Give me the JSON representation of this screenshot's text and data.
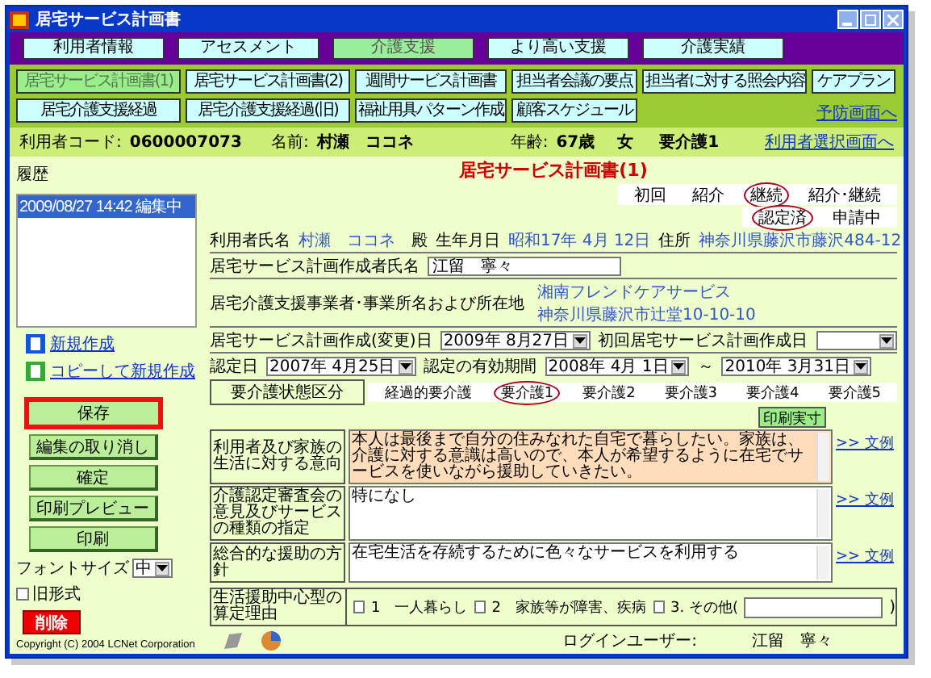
{
  "window": {
    "title": "居宅サービス計画書"
  },
  "main_tabs": [
    {
      "label": "利用者情報",
      "selected": false
    },
    {
      "label": "アセスメント",
      "selected": false
    },
    {
      "label": "介護支援",
      "selected": true
    },
    {
      "label": "より高い支援",
      "selected": false
    },
    {
      "label": "介護実績",
      "selected": false
    }
  ],
  "sub_tabs": [
    {
      "label": "居宅サービス計画書(1)",
      "selected": true
    },
    {
      "label": "居宅サービス計画書(2)",
      "selected": false
    },
    {
      "label": "週間サービス計画書",
      "selected": false
    },
    {
      "label": "担当者会議の要点",
      "selected": false
    },
    {
      "label": "担当者に対する照会内容",
      "selected": false
    },
    {
      "label": "ケアプラン",
      "selected": false
    },
    {
      "label": "居宅介護支援経過",
      "selected": false
    },
    {
      "label": "居宅介護支援経過(旧)",
      "selected": false
    },
    {
      "label": "福祉用具パターン作成",
      "selected": false
    },
    {
      "label": "顧客スケジュール",
      "selected": false
    }
  ],
  "prevention_link": "予防画面へ",
  "user_bar": {
    "code_label": "利用者コード:",
    "code": "0600007073",
    "name_label": "名前:",
    "name": "村瀬　ココネ",
    "age_label": "年齢:",
    "age": "67歳",
    "sex": "女",
    "care_level": "要介護1",
    "select_link": "利用者選択画面へ"
  },
  "history": {
    "title": "履歴",
    "items": [
      {
        "text": "2009/08/27 14:42 編集中",
        "selected": true
      }
    ]
  },
  "new_link": "新規作成",
  "copy_link": "コピーして新規作成",
  "buttons": [
    {
      "label": "保存",
      "highlighted": true
    },
    {
      "label": "編集の取り消し",
      "highlighted": false
    },
    {
      "label": "確定",
      "highlighted": false
    },
    {
      "label": "印刷プレビュー",
      "highlighted": false
    },
    {
      "label": "印刷",
      "highlighted": false
    }
  ],
  "font_size": {
    "label": "フォントサイズ",
    "value": "中"
  },
  "old_format": {
    "label": "旧形式",
    "checked": false
  },
  "delete_button": "削除",
  "copyright": "Copyright (C) 2004 LCNet Corporation",
  "form": {
    "heading": "居宅サービス計画書(1)",
    "plan_types": [
      {
        "label": "初回",
        "selected": false
      },
      {
        "label": "紹介",
        "selected": false
      },
      {
        "label": "継続",
        "selected": true
      },
      {
        "label": "紹介･継続",
        "selected": false
      }
    ],
    "cert_states": [
      {
        "label": "認定済",
        "selected": true
      },
      {
        "label": "申請中",
        "selected": false
      }
    ],
    "user_name_label": "利用者氏名",
    "user_name": "村瀬　ココネ",
    "honorific": "殿",
    "birth_label": "生年月日",
    "birth": "昭和17年 4月 12日",
    "address_label": "住所",
    "address": "神奈川県藤沢市藤沢484-12",
    "planner_label": "居宅サービス計画作成者氏名",
    "planner": "江留　寧々",
    "office_label": "居宅介護支援事業者･事業所名および所在地",
    "office_name": "湘南フレンドケアサービス",
    "office_address": "神奈川県藤沢市辻堂10-10-10",
    "plan_date_label": "居宅サービス計画作成(変更)日",
    "plan_date": "2009年 8月27日",
    "first_date_label": "初回居宅サービス計画作成日",
    "cert_date_label": "認定日",
    "cert_date": "2007年 4月25日",
    "validity_label": "認定の有効期間",
    "valid_from": "2008年 4月 1日",
    "range_sep": "～",
    "valid_to": "2010年 3月31日",
    "level_label": "要介護状態区分",
    "levels": [
      {
        "label": "経過的要介護",
        "selected": false
      },
      {
        "label": "要介護1",
        "selected": true
      },
      {
        "label": "要介護2",
        "selected": false
      },
      {
        "label": "要介護3",
        "selected": false
      },
      {
        "label": "要介護4",
        "selected": false
      },
      {
        "label": "要介護5",
        "selected": false
      }
    ],
    "print_button": "印刷実寸",
    "sections": [
      {
        "label": "利用者及び家族の生活に対する意向",
        "value": "本人は最後まで自分の住みなれた自宅で暮らしたい。家族は、介護に対する意識は高いので、本人が希望するように在宅でサービスを使いながら援助していきたい。",
        "highlighted": true,
        "link": ">> 文例"
      },
      {
        "label": "介護認定審査会の意見及びサービスの種類の指定",
        "value": "特になし",
        "highlighted": false,
        "link": ">> 文例"
      },
      {
        "label": "総合的な援助の方針",
        "value": "在宅生活を存続するために色々なサービスを利用する",
        "highlighted": false,
        "link": ">> 文例"
      }
    ],
    "reason_label": "生活援助中心型の算定理由",
    "reasons": [
      {
        "label": "1　一人暮らし",
        "checked": false
      },
      {
        "label": "2　家族等が障害、疾病",
        "checked": false
      },
      {
        "label": "3. その他(",
        "checked": false
      }
    ],
    "reason_close": ")"
  },
  "footer": {
    "login_label": "ログインユーザー:",
    "login_user": "江留　寧々"
  }
}
